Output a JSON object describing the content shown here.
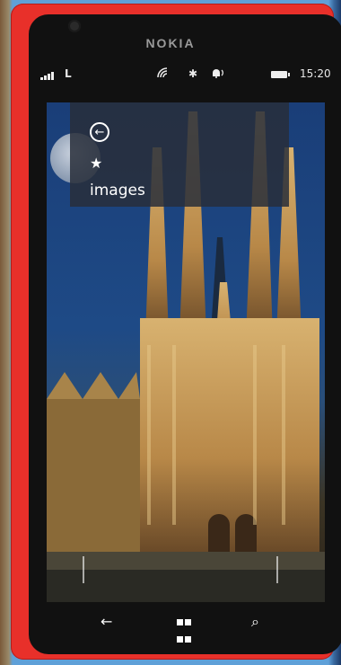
{
  "device": {
    "brand": "NOKIA"
  },
  "status_bar": {
    "carrier": "L",
    "time": "15:20"
  },
  "overlay": {
    "label": "images"
  },
  "icons": {
    "signal": "signal-icon",
    "wifi": "wifi-icon",
    "bluetooth": "bluetooth-icon",
    "ringer": "ringer-icon",
    "battery": "battery-icon",
    "back_circle": "back-arrow-circle-icon",
    "star": "star-icon",
    "nav_back": "nav-back-icon",
    "nav_start": "windows-start-icon",
    "nav_search": "nav-search-icon"
  }
}
